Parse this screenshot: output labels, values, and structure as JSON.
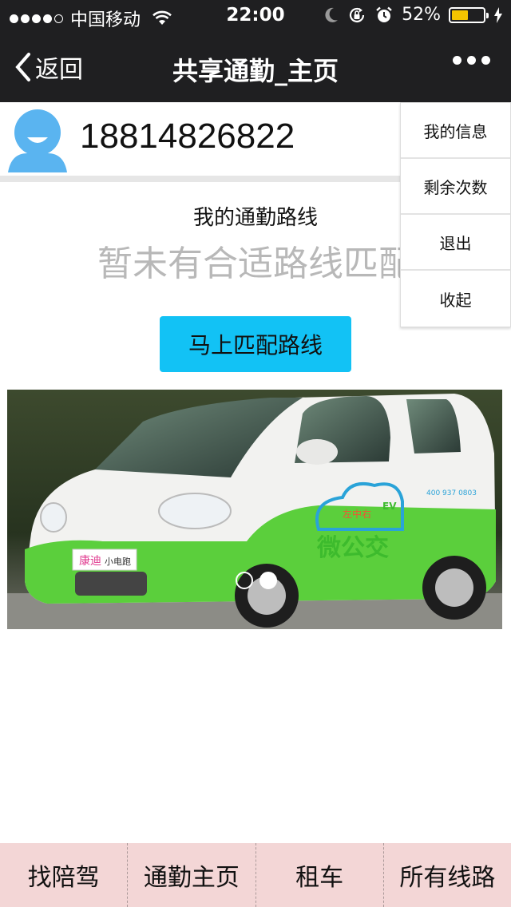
{
  "status_bar": {
    "carrier": "中国移动",
    "time": "22:00",
    "battery_percent": "52%",
    "battery_level": 0.52,
    "icons": [
      "wifi-icon",
      "moon-icon",
      "rotation-lock-icon",
      "alarm-icon",
      "charging-icon"
    ]
  },
  "nav": {
    "back_label": "返回",
    "title": "共享通勤_主页",
    "more_icon": "more-dots-icon"
  },
  "profile": {
    "phone": "18814826822",
    "avatar_icon": "user-avatar-icon"
  },
  "route": {
    "title": "我的通勤路线",
    "empty_text": "暂未有合适路线匹配",
    "match_button": "马上匹配路线"
  },
  "banner": {
    "slide_count": 2,
    "active_slide": 2,
    "car_plate_text": "康迪",
    "car_plate_text2": "小电跑",
    "car_logo_text": "微公交",
    "car_logo_top": "左中右",
    "car_logo_badge": "EV",
    "car_phone_text": "400 937 0803"
  },
  "popup_menu": {
    "items": [
      "我的信息",
      "剩余次数",
      "退出",
      "收起"
    ]
  },
  "tab_bar": {
    "tabs": [
      "找陪驾",
      "通勤主页",
      "租车",
      "所有线路"
    ]
  },
  "colors": {
    "header_bg": "#1f1f21",
    "accent_button": "#12c2f5",
    "tab_bar_bg": "#f3d6d6",
    "avatar_blue": "#5ab4f0",
    "battery_yellow": "#f5c400"
  }
}
